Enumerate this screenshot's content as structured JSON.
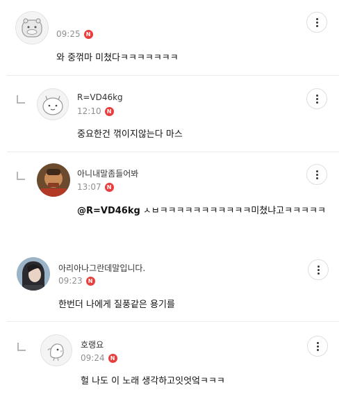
{
  "comments": [
    {
      "name": "",
      "time": "09:25",
      "badge": "N",
      "text": "와 중꺾마 미쳤다ㅋㅋㅋㅋㅋㅋㅋ",
      "avatar_icon": "hippo-face-icon"
    },
    {
      "name": "R=VD46kg",
      "time": "12:10",
      "badge": "N",
      "text": "중요한건 꺾이지않는다 마스",
      "avatar_icon": "round-creature-icon"
    },
    {
      "name": "아니내말좀들어봐",
      "time": "13:07",
      "badge": "N",
      "mention": "@R=VD46kg",
      "text": "ㅅㅂㅋㅋㅋㅋㅋㅋㅋㅋㅋㅋㅋ미쳤냐고ㅋㅋㅋㅋㅋ",
      "avatar_icon": "photo-avatar-icon"
    },
    {
      "name": "아리아나그란데말입니다.",
      "time": "09:23",
      "badge": "N",
      "text": "한번더 나에게 질풍같은 용기를",
      "avatar_icon": "photo-avatar-icon"
    },
    {
      "name": "호랭요",
      "time": "09:24",
      "badge": "N",
      "text": "헐 나도 이 노래 생각하고잇엇엌ㅋㅋㅋ",
      "avatar_icon": "bird-icon"
    }
  ],
  "colors": {
    "badge": "#ea3e3e",
    "divider": "#ebebeb",
    "time": "#8f8f8f"
  }
}
